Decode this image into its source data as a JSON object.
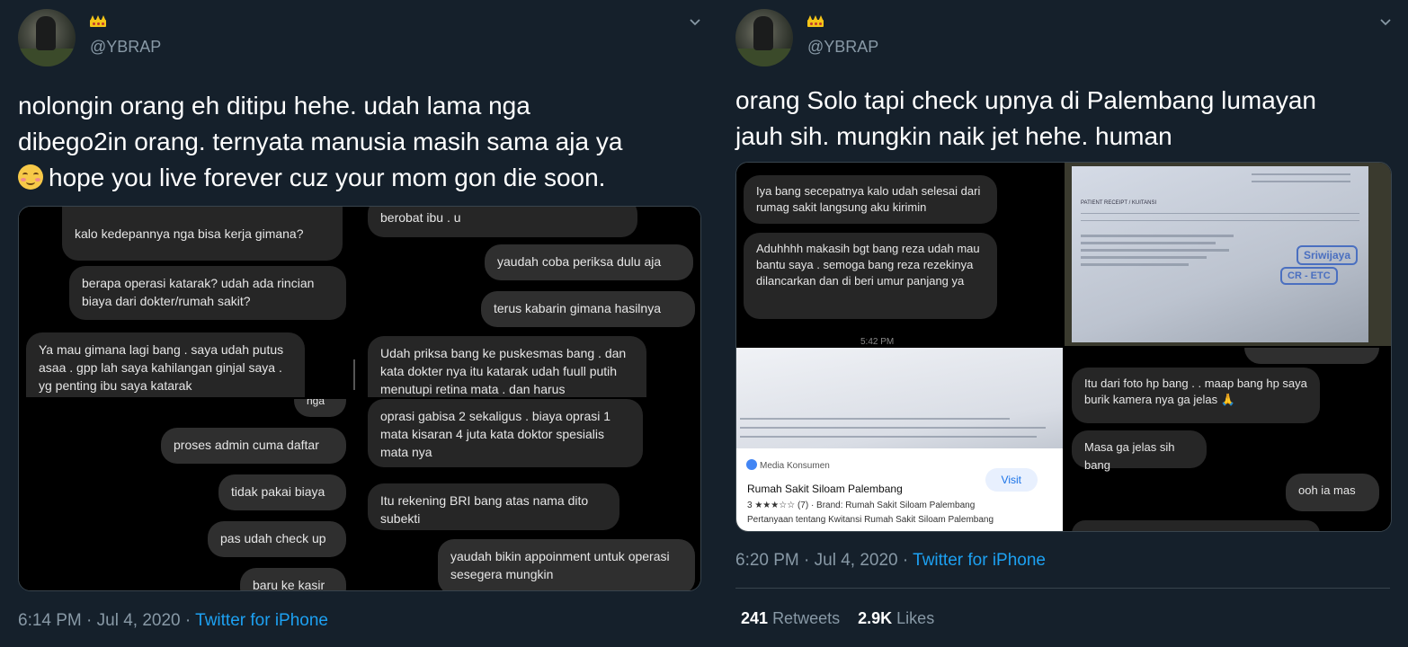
{
  "tweets": [
    {
      "handle": "@YBRAP",
      "text_line1": "nolongin orang eh ditipu hehe. udah lama nga",
      "text_line2": "dibego2in orang. ternyata manusia masih sama aja ya",
      "text_line3": "hope you live forever cuz your mom gon die soon.",
      "timestamp": "6:14 PM · Jul 4, 2020 · ",
      "source": "Twitter for iPhone",
      "media": {
        "cell1": {
          "partial_top": "",
          "b1": "kalo kedepannya nga bisa kerja gimana?",
          "b2": "berapa operasi katarak? udah ada rincian biaya dari dokter/rumah sakit?",
          "b3": "Ya mau gimana lagi bang . saya udah putus asaa . gpp lah saya kahilangan ginjal saya . yg penting ibu saya katarak"
        },
        "cell2": {
          "b1": "berobat ibu . u",
          "b2": "yaudah coba periksa dulu aja",
          "b3": "terus kabarin gimana hasilnya",
          "b4": "Udah priksa bang ke puskesmas bang . dan kata dokter nya itu katarak udah fuull putih menutupi retina mata . dan harus"
        },
        "cell3": {
          "b0": "nga",
          "b1": "proses admin cuma daftar",
          "b2": "tidak pakai biaya",
          "b3": "pas udah check up",
          "b4": "baru ke kasir"
        },
        "cell4": {
          "b1": "oprasi gabisa 2 sekaligus . biaya oprasi 1 mata kisaran 4 juta kata doktor spesialis mata nya",
          "b2": "Itu rekening BRI bang atas nama dito subekti",
          "b3": "yaudah bikin appoinment untuk operasi sesegera mungkin"
        }
      }
    },
    {
      "handle": "@YBRAP",
      "text_line1": "orang Solo tapi check upnya di Palembang lumayan",
      "text_line2": "jauh sih. mungkin naik jet hehe. human",
      "timestamp": "6:20 PM · Jul 4, 2020 · ",
      "source": "Twitter for iPhone",
      "retweets": "241",
      "retweets_label": "Retweets",
      "likes": "2.9K",
      "likes_label": "Likes",
      "media": {
        "cell1": {
          "b1": "Iya bang secepatnya kalo udah selesai dari rumag sakit langsung aku kirimin",
          "b2": "Aduhhhh makasih bgt bang reza udah mau bantu saya . semoga bang reza rezekinya dilancarkan dan di beri umur panjang ya",
          "time": "5:42 PM"
        },
        "cell2": {
          "doc_title": "PATIENT RECEIPT / KUITANSI",
          "stamp1": "Sriwijaya",
          "stamp2": "CR - ETC"
        },
        "cell3": {
          "card_source": "Media Konsumen",
          "card_name": "Rumah Sakit Siloam Palembang",
          "card_rating": "3 ★★★☆☆ (7) · Brand: Rumah Sakit Siloam Palembang",
          "card_question": "Pertanyaan tentang Kwitansi Rumah Sakit Siloam Palembang",
          "card_visit": "Visit"
        },
        "cell4": {
          "b1": "Itu dari foto hp bang . . maap bang hp saya burik kamera nya ga jelas 🙏",
          "b2": "Masa ga jelas sih bang",
          "b3": "ooh ia mas"
        }
      }
    }
  ]
}
